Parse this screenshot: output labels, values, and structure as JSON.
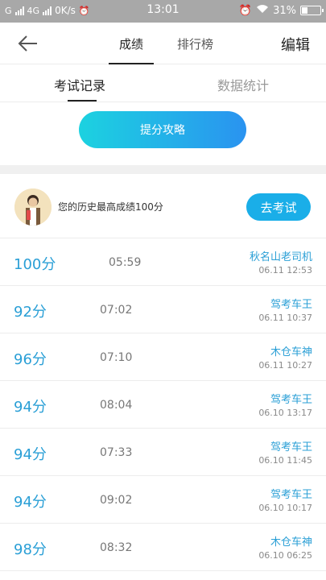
{
  "status_bar": {
    "carrier": "G",
    "network": "4G",
    "speed": "0K/s",
    "time": "13:01",
    "battery": "31%",
    "battery_level": 0.31
  },
  "nav": {
    "tabs": [
      {
        "label": "成绩"
      },
      {
        "label": "排行榜"
      }
    ],
    "edit_label": "编辑"
  },
  "subtabs": [
    {
      "label": "考试记录"
    },
    {
      "label": "数据统计"
    }
  ],
  "promo_label": "提分攻略",
  "history": {
    "text": "您的历史最高成绩100分",
    "button_label": "去考试"
  },
  "records": [
    {
      "score": "100分",
      "duration": "05:59",
      "title": "秋名山老司机",
      "date": "06.11 12:53"
    },
    {
      "score": "92分",
      "duration": "07:02",
      "title": "驾考车王",
      "date": "06.11 10:37"
    },
    {
      "score": "96分",
      "duration": "07:10",
      "title": "木仓车神",
      "date": "06.11 10:27"
    },
    {
      "score": "94分",
      "duration": "08:04",
      "title": "驾考车王",
      "date": "06.10 13:17"
    },
    {
      "score": "94分",
      "duration": "07:33",
      "title": "驾考车王",
      "date": "06.10 11:45"
    },
    {
      "score": "94分",
      "duration": "09:02",
      "title": "驾考车王",
      "date": "06.10 10:17"
    },
    {
      "score": "98分",
      "duration": "08:32",
      "title": "木仓车神",
      "date": "06.10 06:25"
    }
  ],
  "colors": {
    "accent": "#2a9fd6",
    "button": "#1aaee8",
    "gradient_start": "#1cd2e0",
    "gradient_end": "#2a93f0"
  }
}
